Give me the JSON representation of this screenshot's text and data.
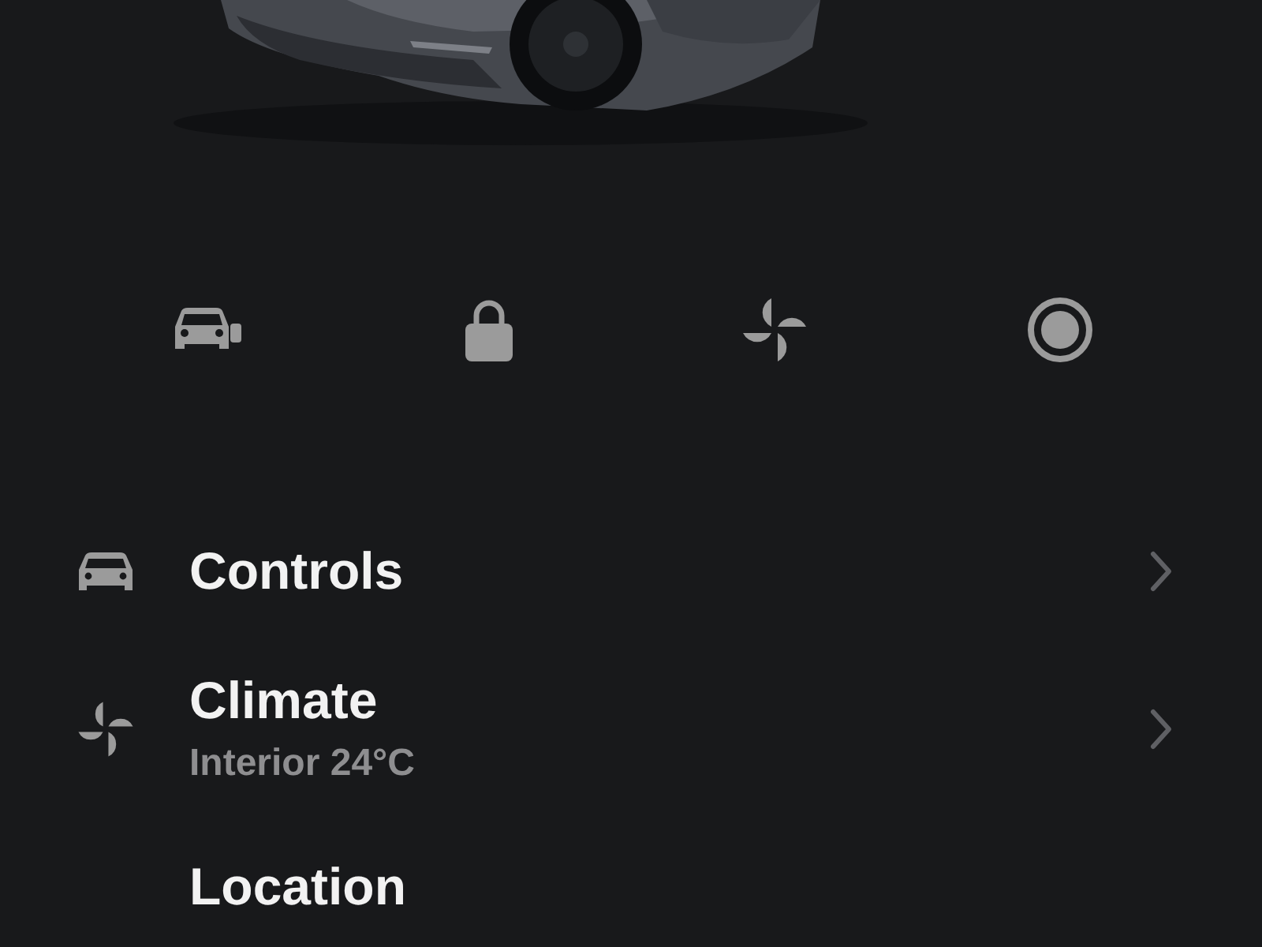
{
  "menu": [
    {
      "title": "Controls"
    },
    {
      "title": "Climate",
      "subtitle": "Interior 24°C"
    },
    {
      "title": "Location"
    }
  ]
}
